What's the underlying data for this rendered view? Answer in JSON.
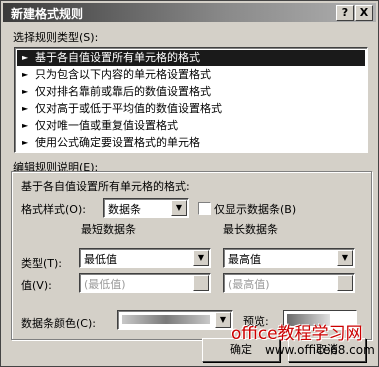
{
  "window": {
    "title": "新建格式规则",
    "help_label": "?",
    "close_label": "X"
  },
  "rule_type": {
    "label_text": "选择规则类型",
    "label_key": "(S):",
    "items": [
      {
        "label": "基于各自值设置所有单元格的格式",
        "selected": true
      },
      {
        "label": "只为包含以下内容的单元格设置格式",
        "selected": false
      },
      {
        "label": "仅对排名靠前或靠后的数值设置格式",
        "selected": false
      },
      {
        "label": "仅对高于或低于平均值的数值设置格式",
        "selected": false
      },
      {
        "label": "仅对唯一值或重复值设置格式",
        "selected": false
      },
      {
        "label": "使用公式确定要设置格式的单元格",
        "selected": false
      }
    ],
    "arrow_glyph": "►"
  },
  "edit": {
    "group_label": "编辑规则说明(E):",
    "description": "基于各自值设置所有单元格的格式:",
    "format_style_label": "格式样式(O):",
    "format_style_value": "数据条",
    "show_bar_only_label": "仅显示数据条(B)",
    "show_bar_only_checked": false,
    "min_header": "最短数据条",
    "max_header": "最长数据条",
    "type_label": "类型(T):",
    "min_type": "最低值",
    "max_type": "最高值",
    "value_label": "值(V):",
    "min_value": "(最低值)",
    "max_value": "(最高值)",
    "bar_color_label": "数据条颜色(C):",
    "preview_label": "预览:"
  },
  "buttons": {
    "ok": "确定",
    "cancel": "取消"
  },
  "watermark": {
    "line1": "office教程学习网",
    "line2": "www.office68.com"
  },
  "colors": {
    "selection": "#1a1a1a",
    "dialog_bg": "#d4d0c8",
    "watermark": "#cc0000"
  },
  "icons": {
    "dropdown": "▼",
    "arrow": "►"
  }
}
